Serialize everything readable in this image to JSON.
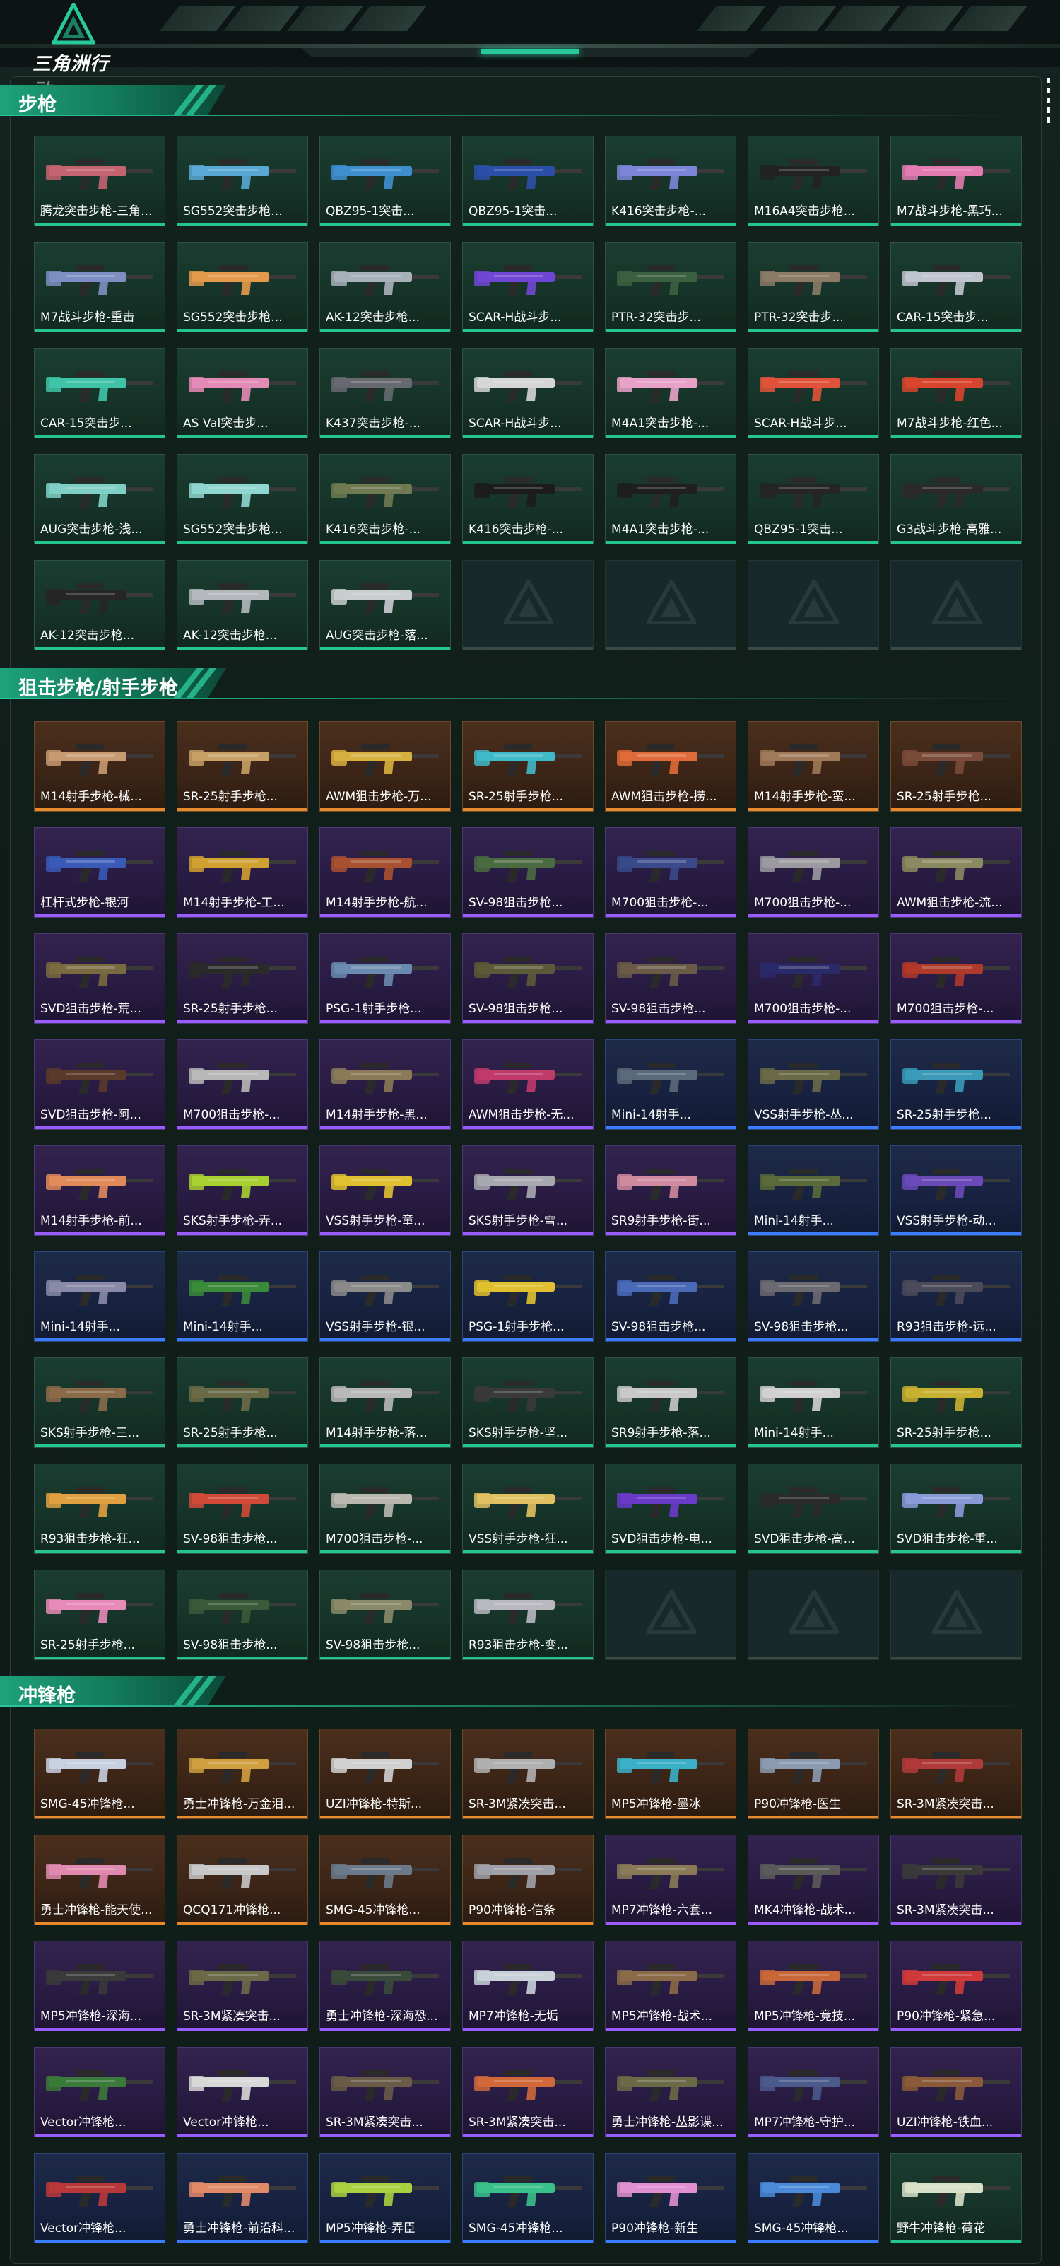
{
  "app": {
    "logo_text": "三角洲行动"
  },
  "colors": {
    "accent": "#27c99a",
    "green_rarity": "#25c58f",
    "gold_rarity": "#e78a2e",
    "purple_rarity": "#9b5cff",
    "blue_rarity": "#3a7dff"
  },
  "sections": [
    {
      "title": "步枪",
      "items": [
        {
          "label": "腾龙突击步枪-三角...",
          "rarity": "green",
          "color": "#c46470"
        },
        {
          "label": "SG552突击步枪...",
          "rarity": "green",
          "color": "#5aa8d4"
        },
        {
          "label": "QBZ95-1突击...",
          "rarity": "green",
          "color": "#3f8fd0"
        },
        {
          "label": "QBZ95-1突击...",
          "rarity": "green",
          "color": "#2b4fa8"
        },
        {
          "label": "K416突击步枪-...",
          "rarity": "green",
          "color": "#7c86d8"
        },
        {
          "label": "M16A4突击步枪...",
          "rarity": "green",
          "color": "#222222"
        },
        {
          "label": "M7战斗步枪-黑巧...",
          "rarity": "green",
          "color": "#e27bb0"
        },
        {
          "label": "M7战斗步枪-重击",
          "rarity": "green",
          "color": "#7d8fc2"
        },
        {
          "label": "SG552突击步枪...",
          "rarity": "green",
          "color": "#e59a4b"
        },
        {
          "label": "AK-12突击步枪...",
          "rarity": "green",
          "color": "#a8b0b8"
        },
        {
          "label": "SCAR-H战斗步...",
          "rarity": "green",
          "color": "#7047d4"
        },
        {
          "label": "PTR-32突击步...",
          "rarity": "green",
          "color": "#3b6040"
        },
        {
          "label": "PTR-32突击步...",
          "rarity": "green",
          "color": "#8a7a66"
        },
        {
          "label": "CAR-15突击步...",
          "rarity": "green",
          "color": "#c0c4cf"
        },
        {
          "label": "CAR-15突击步...",
          "rarity": "green",
          "color": "#3fc4a8"
        },
        {
          "label": "AS Val突击步...",
          "rarity": "green",
          "color": "#e48ab6"
        },
        {
          "label": "K437突击步枪-...",
          "rarity": "green",
          "color": "#666a70"
        },
        {
          "label": "SCAR-H战斗步...",
          "rarity": "green",
          "color": "#d6d6d6"
        },
        {
          "label": "M4A1突击步枪-...",
          "rarity": "green",
          "color": "#e8a2c8"
        },
        {
          "label": "SCAR-H战斗步...",
          "rarity": "green",
          "color": "#e0533a"
        },
        {
          "label": "M7战斗步枪-红色...",
          "rarity": "green",
          "color": "#d8452e"
        },
        {
          "label": "AUG突击步枪-浅...",
          "rarity": "green",
          "color": "#7fcfc6"
        },
        {
          "label": "SG552突击步枪...",
          "rarity": "green",
          "color": "#8ed6cf"
        },
        {
          "label": "K416突击步枪-...",
          "rarity": "green",
          "color": "#6f7a52"
        },
        {
          "label": "K416突击步枪-...",
          "rarity": "green",
          "color": "#1c1c1c"
        },
        {
          "label": "M4A1突击步枪-...",
          "rarity": "green",
          "color": "#1f1f1f"
        },
        {
          "label": "QBZ95-1突击...",
          "rarity": "green",
          "color": "#252525"
        },
        {
          "label": "G3战斗步枪-高雅...",
          "rarity": "green",
          "color": "#2a2a2a"
        },
        {
          "label": "AK-12突击步枪...",
          "rarity": "green",
          "color": "#262626"
        },
        {
          "label": "AK-12突击步枪...",
          "rarity": "green",
          "color": "#b4b8bd"
        },
        {
          "label": "AUG突击步枪-落...",
          "rarity": "green",
          "color": "#c9ccd0"
        },
        {
          "label": "",
          "rarity": "empty"
        },
        {
          "label": "",
          "rarity": "empty"
        },
        {
          "label": "",
          "rarity": "empty"
        },
        {
          "label": "",
          "rarity": "empty"
        }
      ]
    },
    {
      "title": "狙击步枪/射手步枪",
      "items": [
        {
          "label": "M14射手步枪-械...",
          "rarity": "gold",
          "color": "#c89a72"
        },
        {
          "label": "SR-25射手步枪...",
          "rarity": "gold",
          "color": "#c8a065"
        },
        {
          "label": "AWM狙击步枪-万...",
          "rarity": "gold",
          "color": "#d8b040"
        },
        {
          "label": "SR-25射手步枪...",
          "rarity": "gold",
          "color": "#3fb8c8"
        },
        {
          "label": "AWM狙击步枪-捞...",
          "rarity": "gold",
          "color": "#e06a3a"
        },
        {
          "label": "M14射手步枪-蛮...",
          "rarity": "gold",
          "color": "#a07a58"
        },
        {
          "label": "SR-25射手步枪...",
          "rarity": "gold",
          "color": "#7a4a3a"
        },
        {
          "label": "杠杆式步枪-银河",
          "rarity": "purple",
          "color": "#3a5ab8"
        },
        {
          "label": "M14射手步枪-工...",
          "rarity": "purple",
          "color": "#d0a030"
        },
        {
          "label": "M14射手步枪-航...",
          "rarity": "purple",
          "color": "#a85030"
        },
        {
          "label": "SV-98狙击步枪...",
          "rarity": "purple",
          "color": "#4a6a40"
        },
        {
          "label": "M700狙击步枪-...",
          "rarity": "purple",
          "color": "#3a4a8a"
        },
        {
          "label": "M700狙击步枪-...",
          "rarity": "purple",
          "color": "#9a9aa0"
        },
        {
          "label": "AWM狙击步枪-流...",
          "rarity": "purple",
          "color": "#8a8a60"
        },
        {
          "label": "SVD狙击步枪-荒...",
          "rarity": "purple",
          "color": "#7a6a40"
        },
        {
          "label": "SR-25射手步枪...",
          "rarity": "purple",
          "color": "#2a2a2a"
        },
        {
          "label": "PSG-1射手步枪...",
          "rarity": "purple",
          "color": "#6a8ab0"
        },
        {
          "label": "SV-98狙击步枪...",
          "rarity": "purple",
          "color": "#5a5a38"
        },
        {
          "label": "SV-98狙击步枪...",
          "rarity": "purple",
          "color": "#6a5a48"
        },
        {
          "label": "M700狙击步枪-...",
          "rarity": "purple",
          "color": "#2a2a6a"
        },
        {
          "label": "M700狙击步枪-...",
          "rarity": "purple",
          "color": "#b03a2a"
        },
        {
          "label": "SVD狙击步枪-阿...",
          "rarity": "purple",
          "color": "#5a3a2a"
        },
        {
          "label": "M700狙击步枪-...",
          "rarity": "purple",
          "color": "#b8b8b8"
        },
        {
          "label": "M14射手步枪-黑...",
          "rarity": "purple",
          "color": "#8a7a58"
        },
        {
          "label": "AWM狙击步枪-无...",
          "rarity": "purple",
          "color": "#c03a6a"
        },
        {
          "label": "Mini-14射手...",
          "rarity": "blue",
          "color": "#5a6a7a"
        },
        {
          "label": "VSS射手步枪-丛...",
          "rarity": "blue",
          "color": "#6a6a48"
        },
        {
          "label": "SR-25射手步枪...",
          "rarity": "blue",
          "color": "#3a9ab8"
        },
        {
          "label": "M14射手步枪-前...",
          "rarity": "purple",
          "color": "#e08a5a"
        },
        {
          "label": "SKS射手步枪-弄...",
          "rarity": "purple",
          "color": "#a8d030"
        },
        {
          "label": "VSS射手步枪-童...",
          "rarity": "purple",
          "color": "#e0c030"
        },
        {
          "label": "SKS射手步枪-雪...",
          "rarity": "purple",
          "color": "#a8a8b0"
        },
        {
          "label": "SR9射手步枪-街...",
          "rarity": "purple",
          "color": "#d08aa0"
        },
        {
          "label": "Mini-14射手...",
          "rarity": "blue",
          "color": "#5a6a3a"
        },
        {
          "label": "VSS射手步枪-动...",
          "rarity": "blue",
          "color": "#6a4ab8"
        },
        {
          "label": "Mini-14射手...",
          "rarity": "blue",
          "color": "#8a8aa8"
        },
        {
          "label": "Mini-14射手...",
          "rarity": "blue",
          "color": "#3a8a3a"
        },
        {
          "label": "VSS射手步枪-银...",
          "rarity": "blue",
          "color": "#8a8a8a"
        },
        {
          "label": "PSG-1射手步枪...",
          "rarity": "blue",
          "color": "#e0c030"
        },
        {
          "label": "SV-98狙击步枪...",
          "rarity": "blue",
          "color": "#4a6ab8"
        },
        {
          "label": "SV-98狙击步枪...",
          "rarity": "blue",
          "color": "#6a6a70"
        },
        {
          "label": "R93狙击步枪-远...",
          "rarity": "blue",
          "color": "#4a4a5a"
        },
        {
          "label": "SKS射手步枪-三...",
          "rarity": "green",
          "color": "#8a6a48"
        },
        {
          "label": "SR-25射手步枪...",
          "rarity": "green",
          "color": "#6a6a48"
        },
        {
          "label": "M14射手步枪-落...",
          "rarity": "green",
          "color": "#b8b8b8"
        },
        {
          "label": "SKS射手步枪-坚...",
          "rarity": "green",
          "color": "#3a3a3a"
        },
        {
          "label": "SR9射手步枪-落...",
          "rarity": "green",
          "color": "#c8c8c8"
        },
        {
          "label": "Mini-14射手...",
          "rarity": "green",
          "color": "#d0d0d0"
        },
        {
          "label": "SR-25射手步枪...",
          "rarity": "green",
          "color": "#c8b030"
        },
        {
          "label": "R93狙击步枪-狂...",
          "rarity": "green",
          "color": "#e0a040"
        },
        {
          "label": "SV-98狙击步枪...",
          "rarity": "green",
          "color": "#d04a3a"
        },
        {
          "label": "M700狙击步枪-...",
          "rarity": "green",
          "color": "#b8b8b0"
        },
        {
          "label": "VSS射手步枪-狂...",
          "rarity": "green",
          "color": "#e0c060"
        },
        {
          "label": "SVD狙击步枪-电...",
          "rarity": "green",
          "color": "#6a3ac8"
        },
        {
          "label": "SVD狙击步枪-高...",
          "rarity": "green",
          "color": "#2a2a2a"
        },
        {
          "label": "SVD狙击步枪-重...",
          "rarity": "green",
          "color": "#8a9ad8"
        },
        {
          "label": "SR-25射手步枪...",
          "rarity": "green",
          "color": "#e88ab8"
        },
        {
          "label": "SV-98狙击步枪...",
          "rarity": "green",
          "color": "#3a5a3a"
        },
        {
          "label": "SV-98狙击步枪...",
          "rarity": "green",
          "color": "#8a8a6a"
        },
        {
          "label": "R93狙击步枪-变...",
          "rarity": "green",
          "color": "#b8b8c0"
        },
        {
          "label": "",
          "rarity": "empty"
        },
        {
          "label": "",
          "rarity": "empty"
        },
        {
          "label": "",
          "rarity": "empty"
        }
      ]
    },
    {
      "title": "冲锋枪",
      "items": [
        {
          "label": "SMG-45冲锋枪...",
          "rarity": "gold",
          "color": "#c8d0e0"
        },
        {
          "label": "勇士冲锋枪-万金泪...",
          "rarity": "gold",
          "color": "#d0a040"
        },
        {
          "label": "UZI冲锋枪-特斯...",
          "rarity": "gold",
          "color": "#d0d0d0"
        },
        {
          "label": "SR-3M紧凑突击...",
          "rarity": "gold",
          "color": "#b0b0b0"
        },
        {
          "label": "MP5冲锋枪-墨冰",
          "rarity": "gold",
          "color": "#3ab0c8"
        },
        {
          "label": "P90冲锋枪-医生",
          "rarity": "gold",
          "color": "#8a9ab0"
        },
        {
          "label": "SR-3M紧凑突击...",
          "rarity": "gold",
          "color": "#b03a3a"
        },
        {
          "label": "勇士冲锋枪-能天使...",
          "rarity": "gold",
          "color": "#e08ab0"
        },
        {
          "label": "QCQ171冲锋枪...",
          "rarity": "gold",
          "color": "#c8c8c8"
        },
        {
          "label": "SMG-45冲锋枪...",
          "rarity": "gold",
          "color": "#6a7a8a"
        },
        {
          "label": "P90冲锋枪-信条",
          "rarity": "gold",
          "color": "#a0a0a8"
        },
        {
          "label": "MP7冲锋枪-六套...",
          "rarity": "purple",
          "color": "#8a7a58"
        },
        {
          "label": "MK4冲锋枪-战术...",
          "rarity": "purple",
          "color": "#5a5a5a"
        },
        {
          "label": "SR-3M紧凑突击...",
          "rarity": "purple",
          "color": "#3a3a3a"
        },
        {
          "label": "MP5冲锋枪-深海...",
          "rarity": "purple",
          "color": "#3a3a3a"
        },
        {
          "label": "SR-3M紧凑突击...",
          "rarity": "purple",
          "color": "#6a6a48"
        },
        {
          "label": "勇士冲锋枪-深海恐...",
          "rarity": "purple",
          "color": "#3a4a3a"
        },
        {
          "label": "MP7冲锋枪-无垢",
          "rarity": "purple",
          "color": "#c8d0d8"
        },
        {
          "label": "MP5冲锋枪-战术...",
          "rarity": "purple",
          "color": "#8a6a48"
        },
        {
          "label": "MP5冲锋枪-竞技...",
          "rarity": "purple",
          "color": "#c8683a"
        },
        {
          "label": "P90冲锋枪-紧急...",
          "rarity": "purple",
          "color": "#d03a3a"
        },
        {
          "label": "Vector冲锋枪...",
          "rarity": "purple",
          "color": "#3a7a3a"
        },
        {
          "label": "Vector冲锋枪...",
          "rarity": "purple",
          "color": "#d8d8d8"
        },
        {
          "label": "SR-3M紧凑突击...",
          "rarity": "purple",
          "color": "#6a5a48"
        },
        {
          "label": "SR-3M紧凑突击...",
          "rarity": "purple",
          "color": "#d0683a"
        },
        {
          "label": "勇士冲锋枪-丛影谍...",
          "rarity": "purple",
          "color": "#6a6a48"
        },
        {
          "label": "MP7冲锋枪-守护...",
          "rarity": "purple",
          "color": "#4a5a8a"
        },
        {
          "label": "UZI冲锋枪-铁血...",
          "rarity": "purple",
          "color": "#8a5a3a"
        },
        {
          "label": "Vector冲锋枪...",
          "rarity": "blue",
          "color": "#b8383a"
        },
        {
          "label": "勇士冲锋枪-前沿科...",
          "rarity": "blue",
          "color": "#e08a6a"
        },
        {
          "label": "MP5冲锋枪-弄臣",
          "rarity": "blue",
          "color": "#a8d040"
        },
        {
          "label": "SMG-45冲锋枪...",
          "rarity": "blue",
          "color": "#3ac08a"
        },
        {
          "label": "P90冲锋枪-新生",
          "rarity": "blue",
          "color": "#e090d0"
        },
        {
          "label": "SMG-45冲锋枪...",
          "rarity": "blue",
          "color": "#4a8ad8"
        },
        {
          "label": "野牛冲锋枪-荷花",
          "rarity": "green",
          "color": "#d8e0c8"
        }
      ]
    }
  ]
}
